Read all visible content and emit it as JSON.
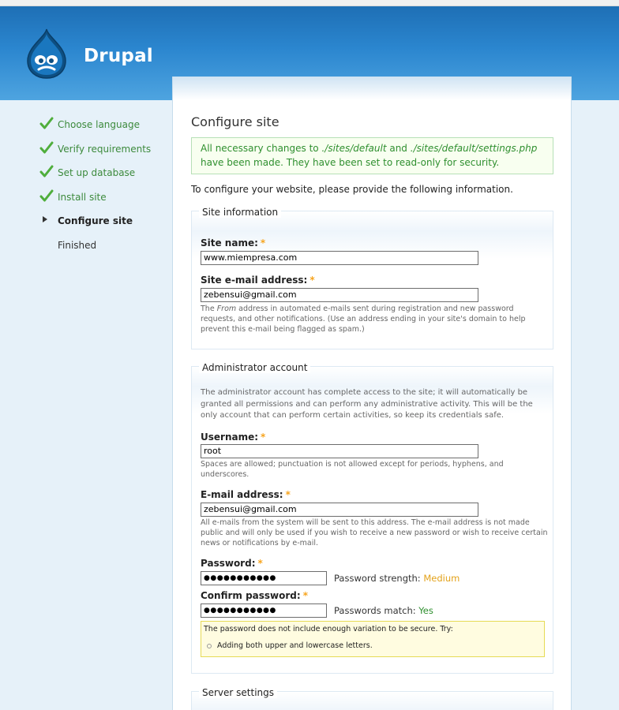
{
  "header": {
    "site_name": "Drupal",
    "logo_icon": "drupal-drop-logo-icon"
  },
  "tasks": [
    {
      "label": "Choose language",
      "state": "done"
    },
    {
      "label": "Verify requirements",
      "state": "done"
    },
    {
      "label": "Set up database",
      "state": "done"
    },
    {
      "label": "Install site",
      "state": "done"
    },
    {
      "label": "Configure site",
      "state": "active"
    },
    {
      "label": "Finished",
      "state": "pending"
    }
  ],
  "page": {
    "title": "Configure site",
    "status_part1": "All necessary changes to ",
    "status_path1": "./sites/default",
    "status_and": " and ",
    "status_path2": "./sites/default/settings.php",
    "status_part2": " have been made. They have been set to read-only for security.",
    "intro": "To configure your website, please provide the following information."
  },
  "site_info": {
    "legend": "Site information",
    "name_label": "Site name:",
    "name_value": "www.miempresa.com",
    "email_label": "Site e-mail address:",
    "email_value": "zebensui@gmail.com",
    "email_desc_pre": "The ",
    "email_desc_em": "From",
    "email_desc_post": " address in automated e-mails sent during registration and new password requests, and other notifications. (Use an address ending in your site's domain to help prevent this e-mail being flagged as spam.)",
    "required_mark": "*"
  },
  "admin": {
    "legend": "Administrator account",
    "intro": "The administrator account has complete access to the site; it will automatically be granted all permissions and can perform any administrative activity. This will be the only account that can perform certain activities, so keep its credentials safe.",
    "username_label": "Username:",
    "username_value": "root",
    "username_desc": "Spaces are allowed; punctuation is not allowed except for periods, hyphens, and underscores.",
    "email_label": "E-mail address:",
    "email_value": "zebensui@gmail.com",
    "email_desc": "All e-mails from the system will be sent to this address. The e-mail address is not made public and will only be used if you wish to receive a new password or wish to receive certain news or notifications by e-mail.",
    "password_label": "Password:",
    "password_value": "●●●●●●●●●●●",
    "strength_label": "Password strength:",
    "strength_value": "Medium",
    "confirm_label": "Confirm password:",
    "confirm_value": "●●●●●●●●●●●",
    "match_label": "Passwords match:",
    "match_value": "Yes",
    "hint": "The password does not include enough variation to be secure. Try:",
    "suggestion": "Adding both upper and lowercase letters."
  },
  "server": {
    "legend": "Server settings"
  },
  "colors": {
    "header_blue": "#2b86cf",
    "success_green": "#2f8f2f",
    "required_orange": "#f7a41d",
    "hint_yellow": "#fffce0"
  }
}
